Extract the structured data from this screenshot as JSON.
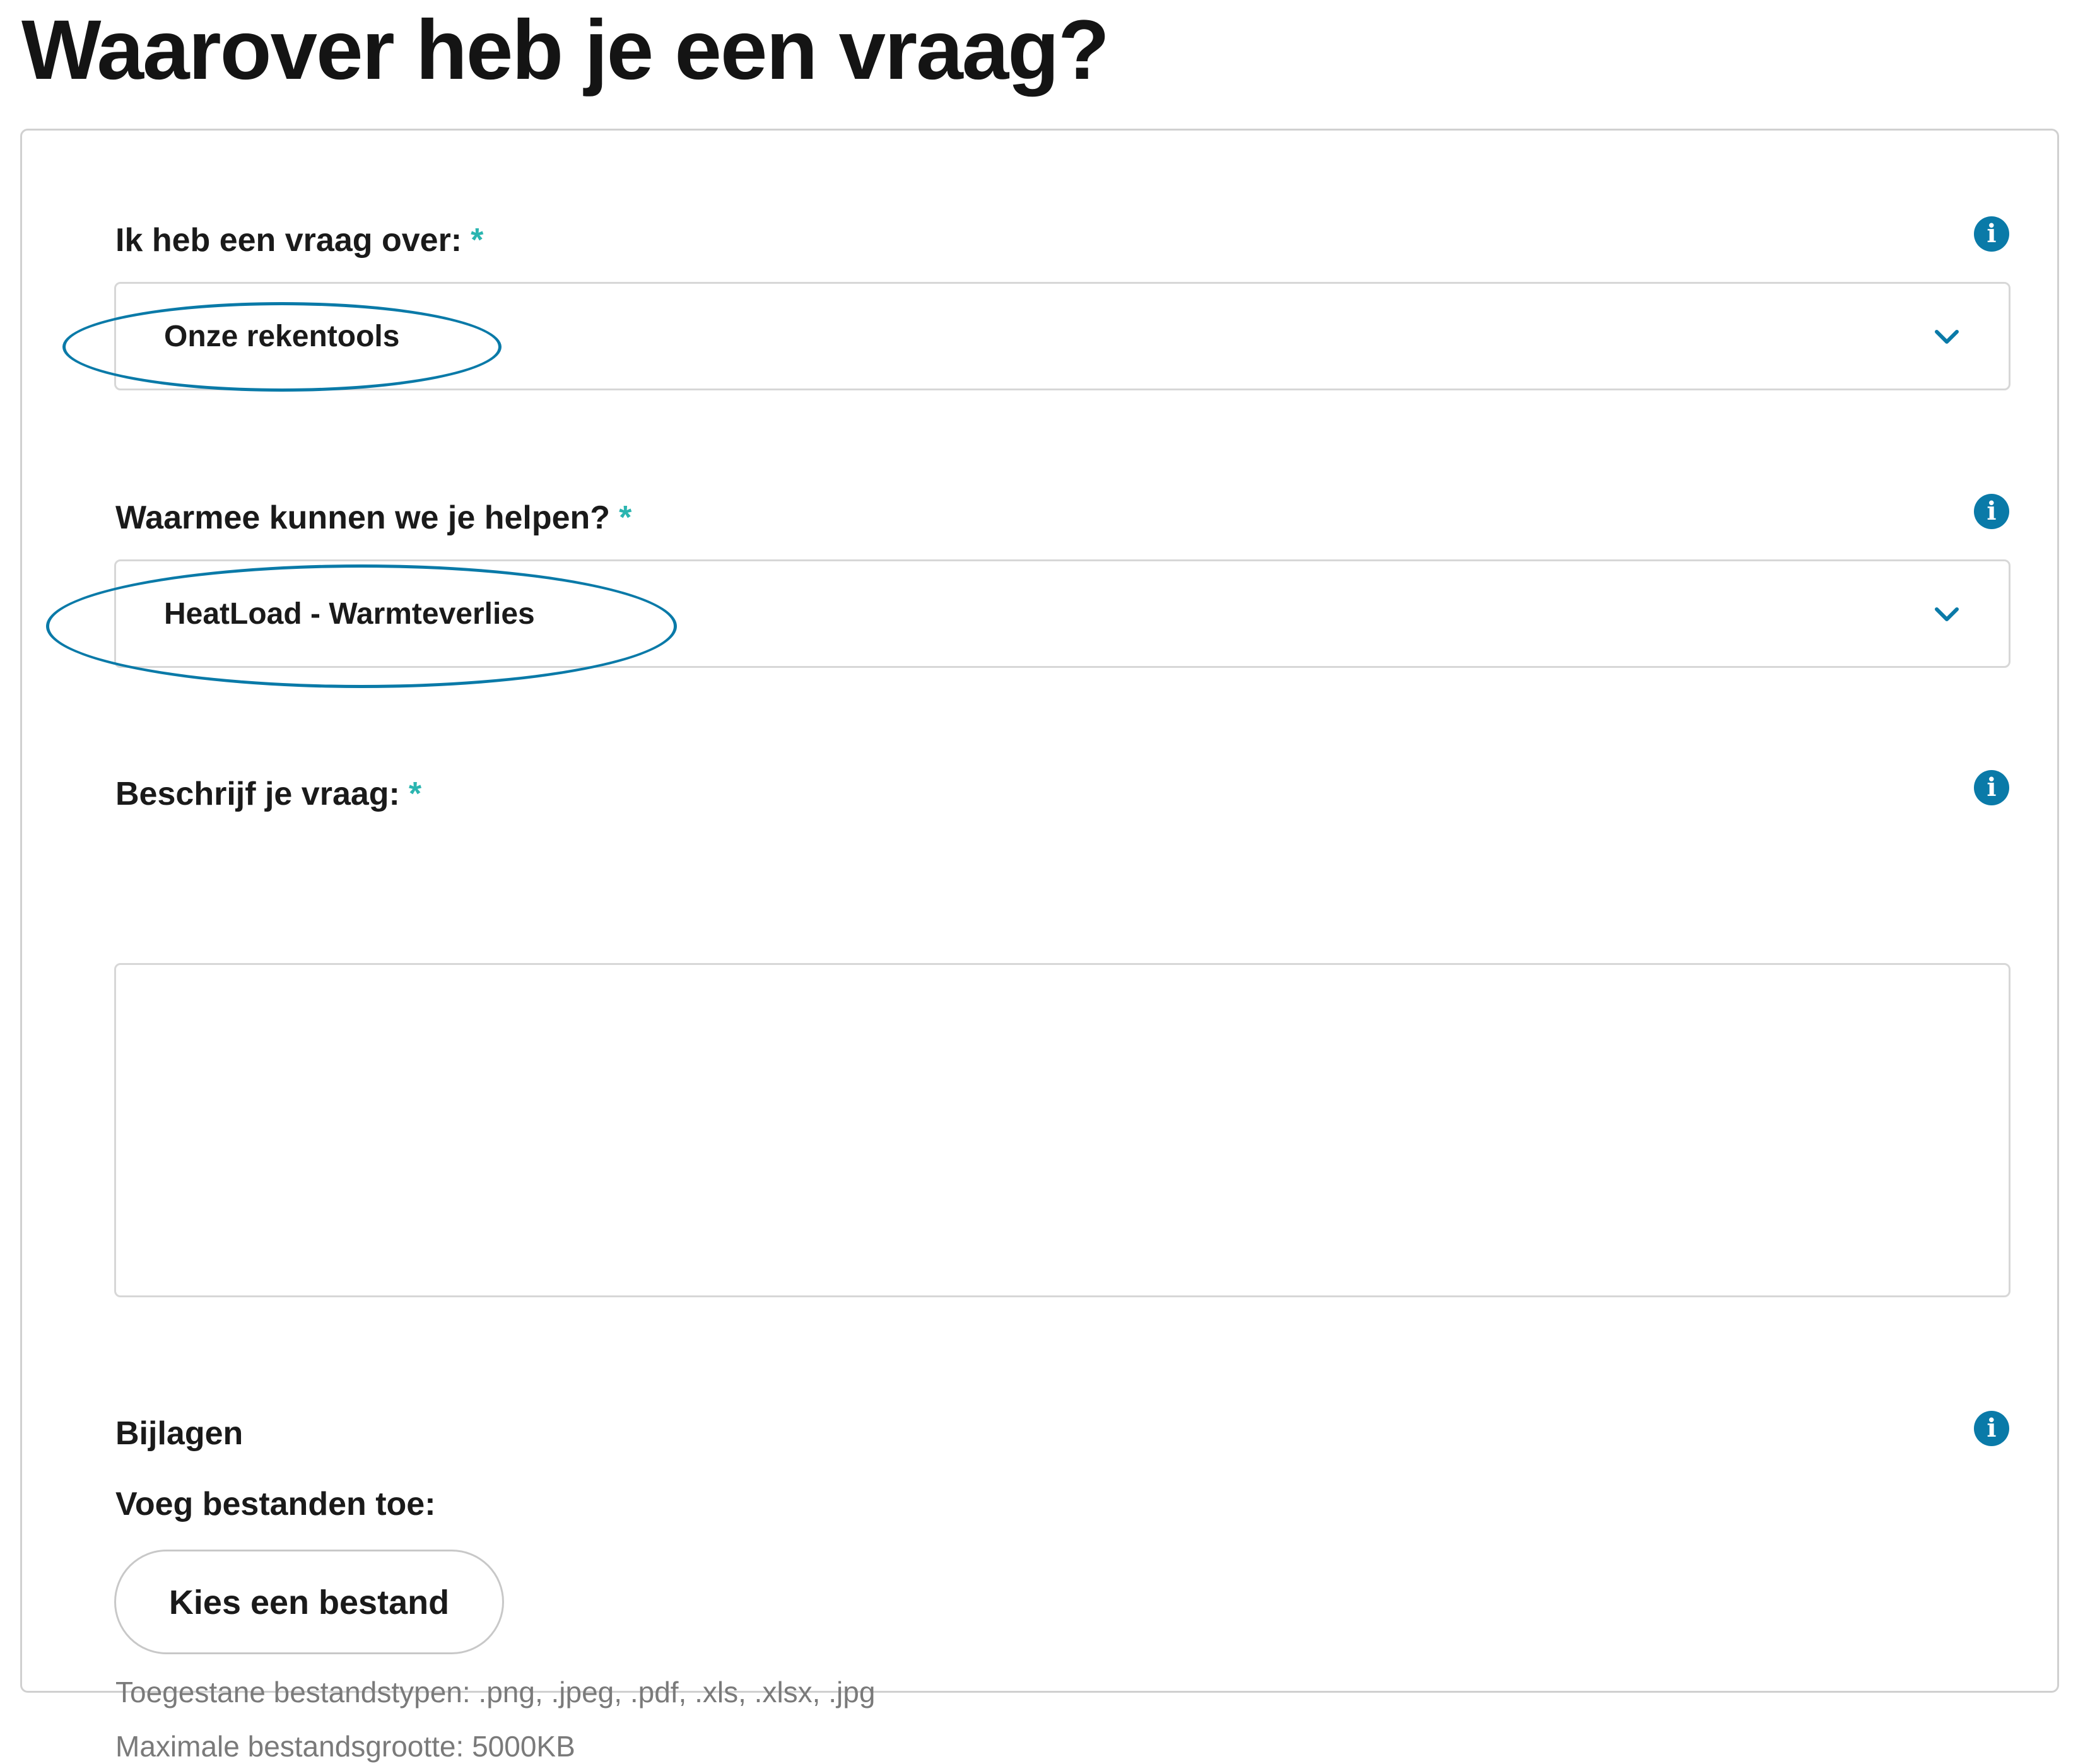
{
  "page": {
    "title": "Waarover heb je een vraag?"
  },
  "form": {
    "required_marker": "*",
    "topic": {
      "label": "Ik heb een vraag over:",
      "value": "Onze rekentools"
    },
    "help": {
      "label": "Waarmee kunnen we je helpen?",
      "value": "HeatLoad - Warmteverlies"
    },
    "description": {
      "label": "Beschrijf je vraag:",
      "value": ""
    },
    "attachments": {
      "heading": "Bijlagen",
      "add_label": "Voeg bestanden toe:",
      "button_label": "Kies een bestand",
      "allowed_types": "Toegestane bestandstypen: .png, .jpeg, .pdf, .xls, .xlsx, .jpg",
      "max_size": "Maximale bestandsgrootte: 5000KB"
    }
  },
  "icons": {
    "info": "info-icon",
    "chevron": "chevron-down-icon"
  },
  "colors": {
    "accent": "#0a7aa8",
    "required": "#2bb5b0",
    "border": "#d7d7d7",
    "hint_text": "#7a7a7a"
  }
}
